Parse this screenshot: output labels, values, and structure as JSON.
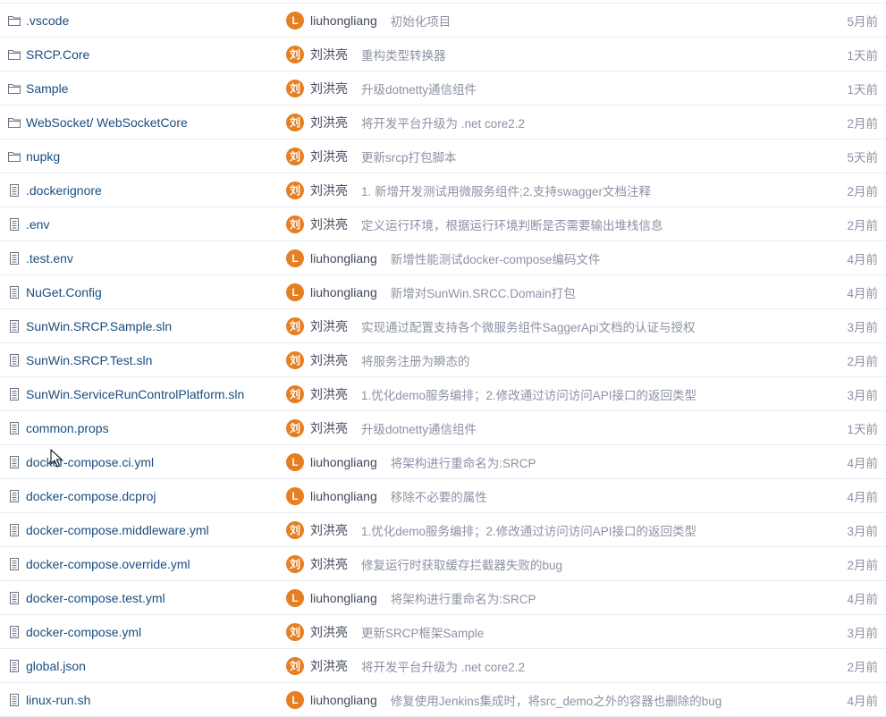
{
  "colors": {
    "link": "#1a4d7f",
    "muted": "#8c92a4",
    "avatar": "#e67e22",
    "border": "#e6ebf0"
  },
  "files": [
    {
      "type": "folder",
      "name": ".vscode",
      "avatar": "L",
      "author": "liuhongliang",
      "message": "初始化项目",
      "time": "5月前"
    },
    {
      "type": "folder",
      "name": "SRCP.Core",
      "avatar": "刘",
      "author": "刘洪亮",
      "message": "重构类型转换器",
      "time": "1天前"
    },
    {
      "type": "folder",
      "name": "Sample",
      "avatar": "刘",
      "author": "刘洪亮",
      "message": "升级dotnetty通信组件",
      "time": "1天前"
    },
    {
      "type": "folder",
      "name": "WebSocket/ WebSocketCore",
      "avatar": "刘",
      "author": "刘洪亮",
      "message": "将开发平台升级为 .net core2.2",
      "time": "2月前"
    },
    {
      "type": "folder",
      "name": "nupkg",
      "avatar": "刘",
      "author": "刘洪亮",
      "message": "更新srcp打包脚本",
      "time": "5天前"
    },
    {
      "type": "file",
      "name": ".dockerignore",
      "avatar": "刘",
      "author": "刘洪亮",
      "message": "1. 新增开发测试用微服务组件;2.支持swagger文档注释",
      "time": "2月前"
    },
    {
      "type": "file",
      "name": ".env",
      "avatar": "刘",
      "author": "刘洪亮",
      "message": "定义运行环境，根据运行环境判断是否需要输出堆栈信息",
      "time": "2月前"
    },
    {
      "type": "file",
      "name": ".test.env",
      "avatar": "L",
      "author": "liuhongliang",
      "message": "新增性能测试docker-compose编码文件",
      "time": "4月前"
    },
    {
      "type": "file",
      "name": "NuGet.Config",
      "avatar": "L",
      "author": "liuhongliang",
      "message": "新增对SunWin.SRCC.Domain打包",
      "time": "4月前"
    },
    {
      "type": "file",
      "name": "SunWin.SRCP.Sample.sln",
      "avatar": "刘",
      "author": "刘洪亮",
      "message": "实现通过配置支持各个微服务组件SaggerApi文档的认证与授权",
      "time": "3月前"
    },
    {
      "type": "file",
      "name": "SunWin.SRCP.Test.sln",
      "avatar": "刘",
      "author": "刘洪亮",
      "message": "将服务注册为瞬态的",
      "time": "2月前"
    },
    {
      "type": "file",
      "name": "SunWin.ServiceRunControlPlatform.sln",
      "avatar": "刘",
      "author": "刘洪亮",
      "message": "1.优化demo服务编排；2.修改通过访问访问API接口的返回类型",
      "time": "3月前"
    },
    {
      "type": "file",
      "name": "common.props",
      "avatar": "刘",
      "author": "刘洪亮",
      "message": "升级dotnetty通信组件",
      "time": "1天前"
    },
    {
      "type": "file",
      "name": "docker-compose.ci.yml",
      "avatar": "L",
      "author": "liuhongliang",
      "message": "将架构进行重命名为:SRCP",
      "time": "4月前"
    },
    {
      "type": "file",
      "name": "docker-compose.dcproj",
      "avatar": "L",
      "author": "liuhongliang",
      "message": "移除不必要的属性",
      "time": "4月前"
    },
    {
      "type": "file",
      "name": "docker-compose.middleware.yml",
      "avatar": "刘",
      "author": "刘洪亮",
      "message": "1.优化demo服务编排；2.修改通过访问访问API接口的返回类型",
      "time": "3月前"
    },
    {
      "type": "file",
      "name": "docker-compose.override.yml",
      "avatar": "刘",
      "author": "刘洪亮",
      "message": "修复运行时获取缓存拦截器失败的bug",
      "time": "2月前"
    },
    {
      "type": "file",
      "name": "docker-compose.test.yml",
      "avatar": "L",
      "author": "liuhongliang",
      "message": "将架构进行重命名为:SRCP",
      "time": "4月前"
    },
    {
      "type": "file",
      "name": "docker-compose.yml",
      "avatar": "刘",
      "author": "刘洪亮",
      "message": "更新SRCP框架Sample",
      "time": "3月前"
    },
    {
      "type": "file",
      "name": "global.json",
      "avatar": "刘",
      "author": "刘洪亮",
      "message": "将开发平台升级为 .net core2.2",
      "time": "2月前"
    },
    {
      "type": "file",
      "name": "linux-run.sh",
      "avatar": "L",
      "author": "liuhongliang",
      "message": "修复使用Jenkins集成时，将src_demo之外的容器也删除的bug",
      "time": "4月前"
    }
  ]
}
